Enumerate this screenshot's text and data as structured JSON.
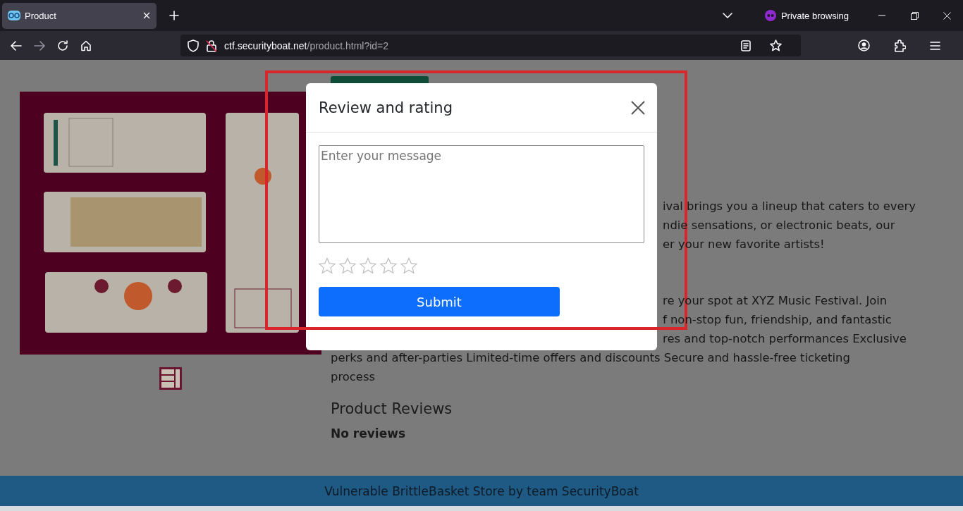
{
  "browser": {
    "tab": {
      "title": "Product",
      "selected": true
    },
    "private_label": "Private browsing",
    "url": {
      "host": "ctf.securityboat.net",
      "path": "/product.html?id=2"
    }
  },
  "page": {
    "description_fragments": [
      {
        "kind": "partial",
        "text": "ival brings you a lineup that caters to every"
      },
      {
        "kind": "partial",
        "text": "ndie sensations, or electronic beats, our"
      },
      {
        "kind": "partial",
        "text": "er your new favorite artists!"
      },
      {
        "kind": "gap"
      },
      {
        "kind": "partial",
        "text": "re your spot at XYZ Music Festival. Join"
      },
      {
        "kind": "partial",
        "text": "f non-stop fun, friendship, and fantastic"
      },
      {
        "kind": "partial",
        "text": "res and top-notch performances Exclusive"
      },
      {
        "kind": "full",
        "text": "perks and after-parties Limited-time offers and discounts Secure and hassle-free ticketing"
      },
      {
        "kind": "full",
        "text": "process"
      }
    ],
    "reviews_heading": "Product Reviews",
    "reviews_empty": "No reviews",
    "footer": "Vulnerable BrittleBasket Store by team SecurityBoat"
  },
  "modal": {
    "title": "Review and rating",
    "message": {
      "placeholder": "Enter your message"
    },
    "rating": {
      "stars": 0
    },
    "submit": "Submit"
  }
}
